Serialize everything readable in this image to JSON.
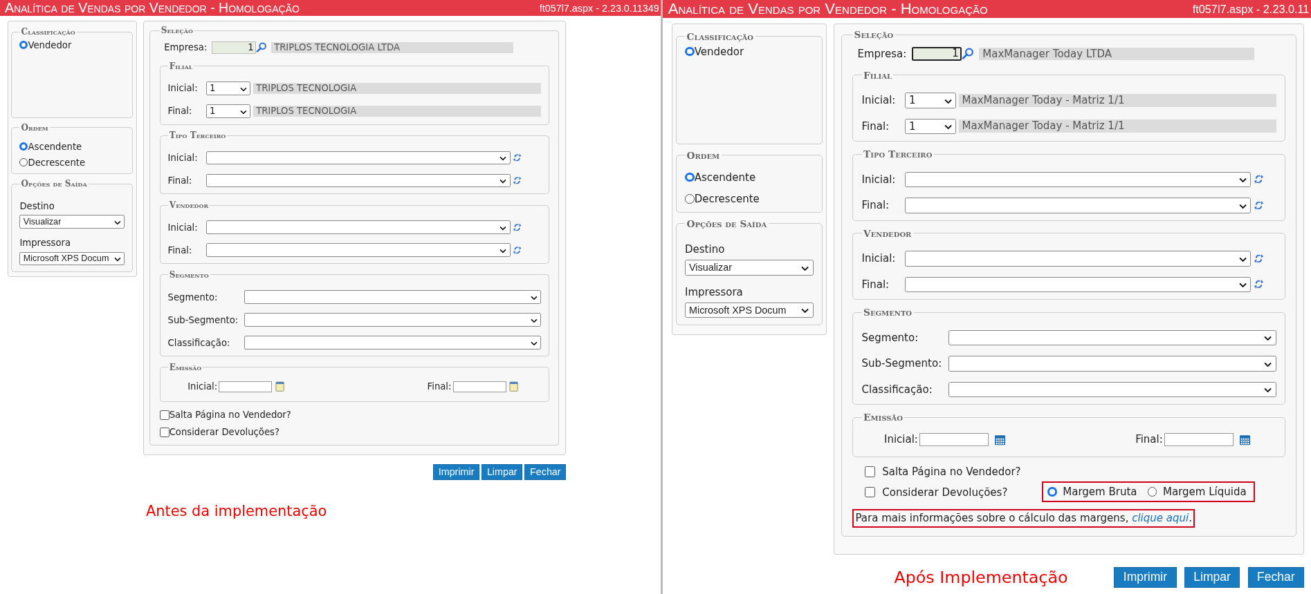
{
  "screens": [
    {
      "kind": "legacy",
      "title": "Analítica de Vendas por Vendedor  - Homologação",
      "version": "ft057l7.aspx - 2.23.0.11349",
      "side": [
        {
          "kind": "radios",
          "legend": "Classificação",
          "options": [
            {
              "label": "Vendedor",
              "selected": true
            }
          ]
        },
        {
          "kind": "radios",
          "legend": "Ordem",
          "options": [
            {
              "label": "Ascendente",
              "selected": true
            },
            {
              "label": "Decrescente",
              "selected": false
            }
          ]
        },
        {
          "kind": "outputs",
          "legend": "Opções de Saída",
          "fields": [
            {
              "label": "Destino",
              "value": "Visualizar"
            },
            {
              "label": "Impressora",
              "value": "Microsoft XPS Docum"
            }
          ]
        }
      ],
      "selecao": {
        "legend": "Seleção",
        "empresa": {
          "label": "Empresa:",
          "value": "1",
          "name": "TRIPLOS TECNOLOGIA LTDA",
          "focused": false
        },
        "groups": [
          {
            "kind": "lookup",
            "legend": "Filial",
            "rows": [
              {
                "label": "Inicial:",
                "value": "1",
                "name": "TRIPLOS TECNOLOGIA"
              },
              {
                "label": "Final:",
                "value": "1",
                "name": "TRIPLOS TECNOLOGIA"
              }
            ]
          },
          {
            "kind": "refresh",
            "legend": "Tipo Terceiro",
            "rows": [
              {
                "label": "Inicial:"
              },
              {
                "label": "Final:"
              }
            ]
          },
          {
            "kind": "refresh",
            "legend": "Vendedor",
            "rows": [
              {
                "label": "Inicial:"
              },
              {
                "label": "Final:"
              }
            ]
          },
          {
            "kind": "select",
            "legend": "Segmento",
            "rows": [
              {
                "label": "Segmento:"
              },
              {
                "label": "Sub-Segmento:"
              },
              {
                "label": "Classificação:"
              }
            ]
          },
          {
            "kind": "date",
            "legend": "Emissão",
            "rows": [
              {
                "label": "Inicial:"
              },
              {
                "label": "Final:"
              }
            ]
          }
        ],
        "checkboxes": [
          {
            "label": "Salta Página no Vendedor?",
            "checked": false
          },
          {
            "label": "Considerar Devoluções?",
            "checked": false
          }
        ]
      },
      "buttons": [
        "Imprimir",
        "Limpar",
        "Fechar"
      ],
      "caption": "Antes da implementação"
    },
    {
      "kind": "modern",
      "title": "Analítica de Vendas por Vendedor  - Homologação",
      "version": "ft057l7.aspx - 2.23.0.11",
      "side": [
        {
          "kind": "radios",
          "legend": "Classificação",
          "options": [
            {
              "label": "Vendedor",
              "selected": true
            }
          ]
        },
        {
          "kind": "radios",
          "legend": "Ordem",
          "options": [
            {
              "label": "Ascendente",
              "selected": true
            },
            {
              "label": "Decrescente",
              "selected": false
            }
          ]
        },
        {
          "kind": "outputs",
          "legend": "Opções de Saída",
          "fields": [
            {
              "label": "Destino",
              "value": "Visualizar"
            },
            {
              "label": "Impressora",
              "value": "Microsoft XPS Docum"
            }
          ]
        }
      ],
      "selecao": {
        "legend": "Seleção",
        "empresa": {
          "label": "Empresa:",
          "value": "1",
          "name": "MaxManager Today LTDA",
          "focused": true
        },
        "groups": [
          {
            "kind": "lookup",
            "legend": "Filial",
            "rows": [
              {
                "label": "Inicial:",
                "value": "1",
                "name": "MaxManager Today - Matriz 1/1"
              },
              {
                "label": "Final:",
                "value": "1",
                "name": "MaxManager Today - Matriz 1/1"
              }
            ]
          },
          {
            "kind": "refresh",
            "legend": "Tipo Terceiro",
            "rows": [
              {
                "label": "Inicial:"
              },
              {
                "label": "Final:"
              }
            ]
          },
          {
            "kind": "refresh",
            "legend": "Vendedor",
            "rows": [
              {
                "label": "Inicial:"
              },
              {
                "label": "Final:"
              }
            ]
          },
          {
            "kind": "select",
            "legend": "Segmento",
            "rows": [
              {
                "label": "Segmento:"
              },
              {
                "label": "Sub-Segmento:"
              },
              {
                "label": "Classificação:"
              }
            ]
          },
          {
            "kind": "date",
            "legend": "Emissão",
            "rows": [
              {
                "label": "Inicial:"
              },
              {
                "label": "Final:"
              }
            ]
          }
        ],
        "checkboxes": [
          {
            "label": "Salta Página no Vendedor?",
            "checked": false
          },
          {
            "label": "Considerar Devoluções?",
            "checked": false
          }
        ],
        "margins": [
          {
            "label": "Margem Bruta",
            "selected": true
          },
          {
            "label": "Margem Líquida",
            "selected": false
          }
        ],
        "info": {
          "text": "Para mais informações sobre o cálculo das margens,",
          "link": "clique aqui",
          "end": "."
        }
      },
      "buttons": [
        "Imprimir",
        "Limpar",
        "Fechar"
      ],
      "caption": "Após Implementação"
    }
  ]
}
